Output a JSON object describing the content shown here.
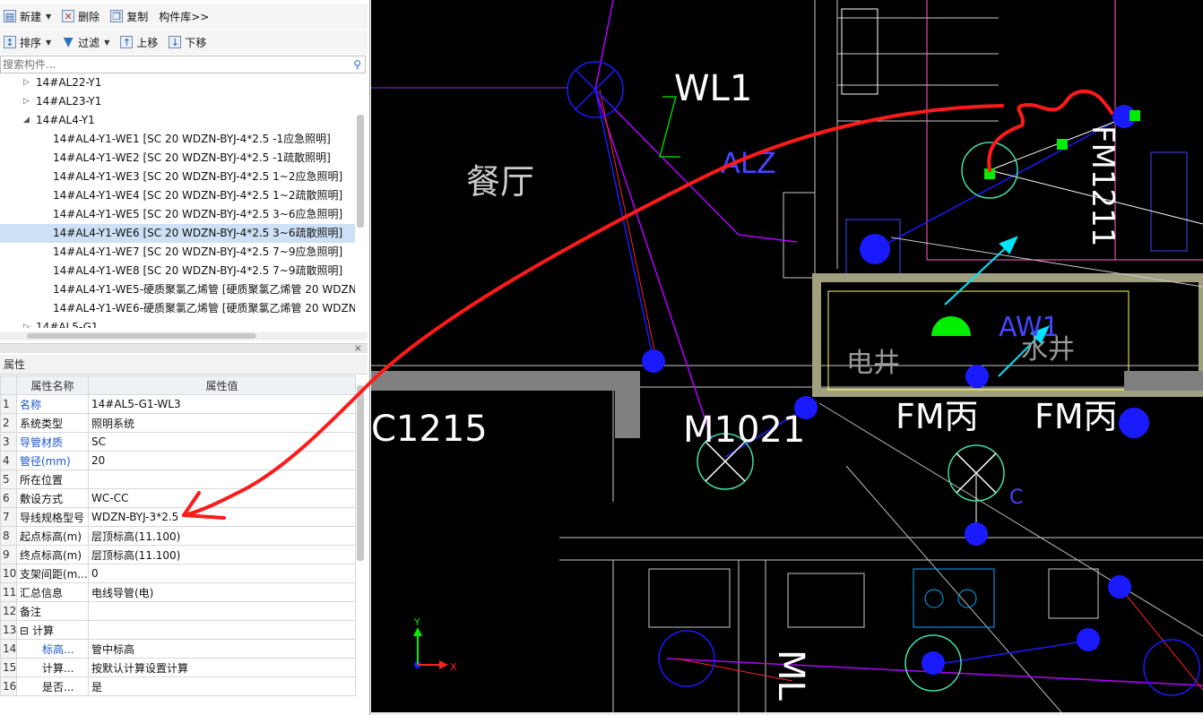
{
  "toolbar1": {
    "new_label": "新建",
    "delete_label": "删除",
    "copy_label": "复制",
    "library_label": "构件库>>"
  },
  "toolbar2": {
    "sort_label": "排序",
    "filter_label": "过滤",
    "move_up_label": "上移",
    "move_down_label": "下移"
  },
  "search": {
    "placeholder": "搜索构件..."
  },
  "tree": [
    {
      "label": "14#AL22-Y1",
      "state": "collapsed",
      "indent": 1
    },
    {
      "label": "14#AL23-Y1",
      "state": "collapsed",
      "indent": 1
    },
    {
      "label": "14#AL4-Y1",
      "state": "expanded",
      "indent": 1
    },
    {
      "label": "14#AL4-Y1-WE1 [SC 20 WDZN-BYJ-4*2.5 -1应急照明]",
      "indent": 2
    },
    {
      "label": "14#AL4-Y1-WE2 [SC 20 WDZN-BYJ-4*2.5 -1疏散照明]",
      "indent": 2
    },
    {
      "label": "14#AL4-Y1-WE3 [SC 20 WDZN-BYJ-4*2.5 1~2应急照明]",
      "indent": 2
    },
    {
      "label": "14#AL4-Y1-WE4 [SC 20 WDZN-BYJ-4*2.5 1~2疏散照明]",
      "indent": 2
    },
    {
      "label": "14#AL4-Y1-WE5 [SC 20 WDZN-BYJ-4*2.5 3~6应急照明]",
      "indent": 2
    },
    {
      "label": "14#AL4-Y1-WE6 [SC 20 WDZN-BYJ-4*2.5 3~6疏散照明]",
      "indent": 2,
      "selected": true
    },
    {
      "label": "14#AL4-Y1-WE7 [SC 20 WDZN-BYJ-4*2.5 7~9应急照明]",
      "indent": 2
    },
    {
      "label": "14#AL4-Y1-WE8 [SC 20 WDZN-BYJ-4*2.5 7~9疏散照明]",
      "indent": 2
    },
    {
      "label": "14#AL4-Y1-WE5-硬质聚氯乙烯管 [硬质聚氯乙烯管 20 WDZN-",
      "indent": 2
    },
    {
      "label": "14#AL4-Y1-WE6-硬质聚氯乙烯管 [硬质聚氯乙烯管 20 WDZN-",
      "indent": 2
    },
    {
      "label": "14#AL5-G1",
      "state": "collapsed",
      "indent": 1
    }
  ],
  "properties": {
    "title": "属性",
    "col_name": "属性名称",
    "col_value": "属性值",
    "rows": [
      {
        "no": "1",
        "name": "名称",
        "value": "14#AL5-G1-WL3",
        "blue": true
      },
      {
        "no": "2",
        "name": "系统类型",
        "value": "照明系统"
      },
      {
        "no": "3",
        "name": "导管材质",
        "value": "SC",
        "blue": true
      },
      {
        "no": "4",
        "name": "管径(mm)",
        "value": "20",
        "blue": true
      },
      {
        "no": "5",
        "name": "所在位置",
        "value": ""
      },
      {
        "no": "6",
        "name": "敷设方式",
        "value": "WC-CC"
      },
      {
        "no": "7",
        "name": "导线规格型号",
        "value": "WDZN-BYJ-3*2.5"
      },
      {
        "no": "8",
        "name": "起点标高(m)",
        "value": "层顶标高(11.100)"
      },
      {
        "no": "9",
        "name": "终点标高(m)",
        "value": "层顶标高(11.100)"
      },
      {
        "no": "10",
        "name": "支架间距(m...",
        "value": "0"
      },
      {
        "no": "11",
        "name": "汇总信息",
        "value": "电线导管(电)"
      },
      {
        "no": "12",
        "name": "备注",
        "value": ""
      },
      {
        "no": "13",
        "name": "计算",
        "value": "",
        "group": true
      },
      {
        "no": "14",
        "name": "标高...",
        "value": "管中标高",
        "blue": true,
        "child": true
      },
      {
        "no": "15",
        "name": "计算...",
        "value": "按默认计算设置计算",
        "child": true
      },
      {
        "no": "16",
        "name": "是否...",
        "value": "是",
        "child": true
      }
    ]
  },
  "cad": {
    "labels": {
      "wl1": "WL1",
      "alz": "ALZ",
      "dining": "餐厅",
      "aw1": "AW1",
      "elec_shaft": "电井",
      "water_shaft": "水井",
      "c1215": "C1215",
      "m1021": "M1021",
      "fm1": "FM丙",
      "fm2": "FM丙",
      "fm1211": "FM1211",
      "ml": "ML",
      "c": "C",
      "axis_x": "X",
      "axis_y": "Y"
    },
    "colors": {
      "background": "#000000",
      "annotation": "#ff1a1a",
      "conduit": "#1a1aff",
      "cable": "#b000ff",
      "wall": "#c8c8c8",
      "highlight": "#00ff00",
      "arrow": "#00e5ff"
    }
  }
}
